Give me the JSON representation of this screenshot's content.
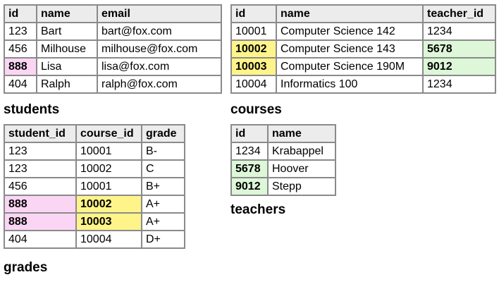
{
  "students": {
    "caption": "students",
    "headers": [
      "id",
      "name",
      "email"
    ],
    "rows": [
      [
        "123",
        "Bart",
        "bart@fox.com"
      ],
      [
        "456",
        "Milhouse",
        "milhouse@fox.com"
      ],
      [
        "888",
        "Lisa",
        "lisa@fox.com"
      ],
      [
        "404",
        "Ralph",
        "ralph@fox.com"
      ]
    ],
    "highlights": {
      "2-0": "pink"
    }
  },
  "courses": {
    "caption": "courses",
    "headers": [
      "id",
      "name",
      "teacher_id"
    ],
    "rows": [
      [
        "10001",
        "Computer Science 142",
        "1234"
      ],
      [
        "10002",
        "Computer Science 143",
        "5678"
      ],
      [
        "10003",
        "Computer Science 190M",
        "9012"
      ],
      [
        "10004",
        "Informatics 100",
        "1234"
      ]
    ],
    "highlights": {
      "1-0": "yellow",
      "2-0": "yellow",
      "1-2": "green",
      "2-2": "green"
    }
  },
  "grades": {
    "caption": "grades",
    "headers": [
      "student_id",
      "course_id",
      "grade"
    ],
    "rows": [
      [
        "123",
        "10001",
        "B-"
      ],
      [
        "123",
        "10002",
        "C"
      ],
      [
        "456",
        "10001",
        "B+"
      ],
      [
        "888",
        "10002",
        "A+"
      ],
      [
        "888",
        "10003",
        "A+"
      ],
      [
        "404",
        "10004",
        "D+"
      ]
    ],
    "highlights": {
      "3-0": "pink",
      "4-0": "pink",
      "3-1": "yellow",
      "4-1": "yellow"
    }
  },
  "teachers": {
    "caption": "teachers",
    "headers": [
      "id",
      "name"
    ],
    "rows": [
      [
        "1234",
        "Krabappel"
      ],
      [
        "5678",
        "Hoover"
      ],
      [
        "9012",
        "Stepp"
      ]
    ],
    "highlights": {
      "1-0": "green",
      "2-0": "green"
    }
  },
  "colors": {
    "pink": "#fbd6f4",
    "yellow": "#fff48a",
    "green": "#ddf7d8",
    "header": "#ececec",
    "border": "#8a8a8a"
  }
}
